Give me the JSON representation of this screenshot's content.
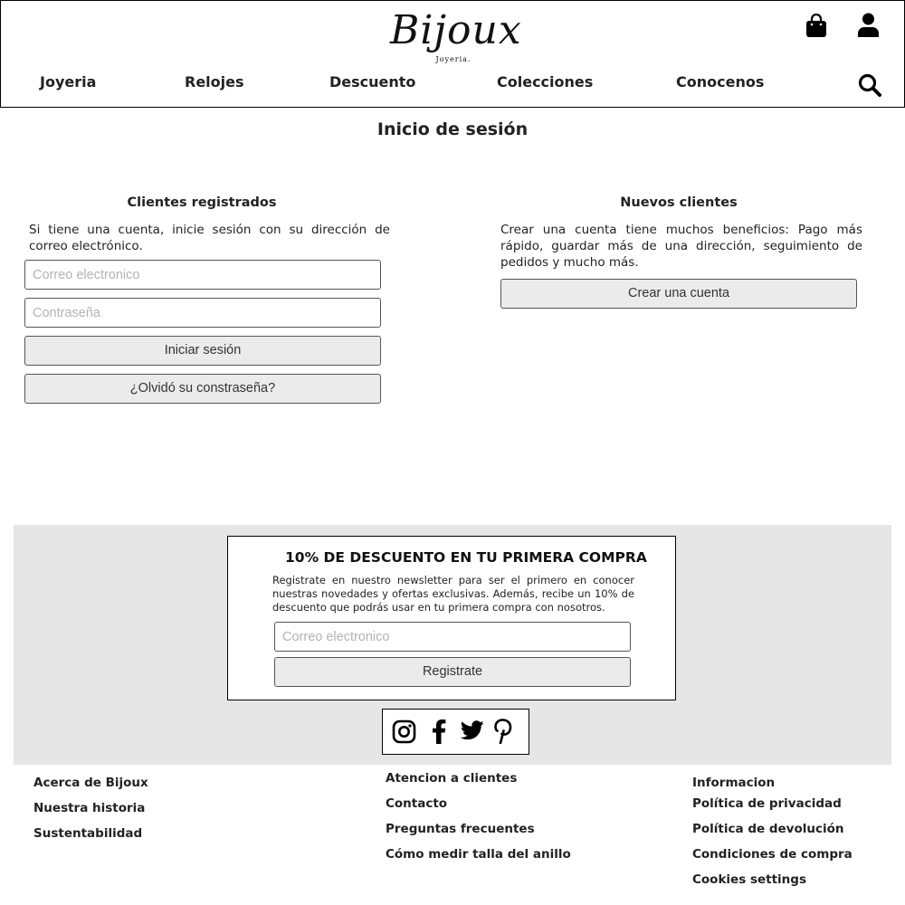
{
  "header": {
    "logo_text": "Bijoux",
    "logo_subtitle": "Joyeria.",
    "nav": [
      "Joyeria",
      "Relojes",
      "Descuento",
      "Colecciones",
      "Conocenos"
    ],
    "icons": [
      "shopping-bag-icon",
      "user-icon",
      "search-icon"
    ]
  },
  "main": {
    "title": "Inicio de sesión",
    "registered": {
      "title": "Clientes registrados",
      "text": "Si tiene una cuenta, inicie sesión con su dirección de correo electrónico.",
      "email_placeholder": "Correo electronico",
      "password_placeholder": "Contraseña",
      "login_button": "Iniciar sesión",
      "forgot_button": "¿Olvidó su constraseña?"
    },
    "new_clients": {
      "title": "Nuevos clientes",
      "text": "Crear una cuenta tiene muchos beneficios: Pago más rápido, guardar más de una dirección, seguimiento de pedidos y mucho más.",
      "create_button": "Crear una cuenta"
    }
  },
  "newsletter": {
    "title": "10% DE DESCUENTO EN TU PRIMERA COMPRA",
    "text": "Registrate en nuestro newsletter para ser el primero en conocer nuestras novedades y ofertas exclusivas. Además, recibe un 10% de descuento que podrás usar en tu primera compra con nosotros.",
    "email_placeholder": "Correo electronico",
    "button": "Registrate"
  },
  "social": [
    "instagram-icon",
    "facebook-icon",
    "twitter-icon",
    "pinterest-icon"
  ],
  "footer": {
    "col1": [
      "Acerca de Bijoux",
      "Nuestra historia",
      "Sustentabilidad"
    ],
    "col2": [
      "Atencion a clientes",
      "Contacto",
      "Preguntas frecuentes",
      "Cómo medir talla del anillo"
    ],
    "col3": [
      "Informacion",
      "Política de privacidad",
      "Política de devolución",
      "Condiciones de compra",
      "Cookies settings"
    ]
  },
  "colors": {
    "band_background": "#e6e6e6",
    "button_background": "#ebebeb",
    "text": "#222222"
  }
}
